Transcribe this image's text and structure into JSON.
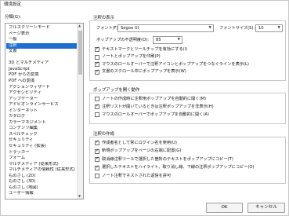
{
  "window": {
    "title": "環境設定"
  },
  "categories": {
    "label": "分類(G):",
    "items": [
      {
        "label": "フルスクリーンモード",
        "bold": false
      },
      {
        "label": "ページ表示",
        "bold": false
      },
      {
        "label": "一般",
        "bold": false
      },
      {
        "label": "注釈",
        "bold": false,
        "selected": true
      },
      {
        "label": "文書",
        "bold": false
      },
      {
        "label": "",
        "bold": false
      },
      {
        "label": "3D とマルチメディア",
        "bold": false
      },
      {
        "label": "JavaScript",
        "bold": false
      },
      {
        "label": "PDF からの変換",
        "bold": false
      },
      {
        "label": "PDF への変換",
        "bold": false
      },
      {
        "label": "アクションウィザード",
        "bold": false
      },
      {
        "label": "アクセシビリティ",
        "bold": false
      },
      {
        "label": "アップデーター",
        "bold": false
      },
      {
        "label": "アドビオンラインサービス",
        "bold": false
      },
      {
        "label": "インターネット",
        "bold": false
      },
      {
        "label": "カタログ",
        "bold": false
      },
      {
        "label": "カラーマネジメント",
        "bold": false
      },
      {
        "label": "コンテンツ編集",
        "bold": false
      },
      {
        "label": "スペルチェック",
        "bold": false
      },
      {
        "label": "セキュリティ",
        "bold": false
      },
      {
        "label": "セキュリティ (拡張)",
        "bold": false
      },
      {
        "label": "トラッカー",
        "bold": false
      },
      {
        "label": "フォーム",
        "bold": false
      },
      {
        "label": "マルチメディア (従来形式)",
        "bold": false
      },
      {
        "label": "マルチメディアの信頼性 (従来形式)",
        "bold": false
      },
      {
        "label": "ものさし (2D)",
        "bold": false
      },
      {
        "label": "ものさし (3D)",
        "bold": false
      },
      {
        "label": "ものさし (地図)",
        "bold": false
      },
      {
        "label": "ユーザー情報",
        "bold": false
      }
    ]
  },
  "display": {
    "title": "注釈の表示",
    "font_label": "フォント(F):",
    "font_value": "Segoe UI",
    "fontsize_label": "フォントサイズ(S):",
    "fontsize_value": "10",
    "opacity_label": "ポップアップの不透明度(O):",
    "opacity_value": "85",
    "options": [
      {
        "label": "テキストマークとツールチップを有効にする(I)",
        "checked": true
      },
      {
        "label": "ノートとポップアップを印刷(P)",
        "checked": false
      },
      {
        "label": "マウスのロールオーバーで注釈アイコンとポップアップをつなぐラインを表示(L)",
        "checked": true
      },
      {
        "label": "文書のスクロール中にポップアップを表示(W)",
        "checked": true
      }
    ]
  },
  "popup": {
    "title": "ポップアップを開く動作",
    "options": [
      {
        "label": "ノートの作成時に注釈用ポップアップを自動的に開く(M)",
        "checked": false
      },
      {
        "label": "注釈リストが開いているときは注釈ポップアップを非表示(H)",
        "checked": true
      },
      {
        "label": "マウスのロールオーバーでポップアップを自動的に開く(A)",
        "checked": false
      }
    ]
  },
  "create": {
    "title": "注釈の作成",
    "options": [
      {
        "label": "作成者名として常にログイン名を使用(U)",
        "checked": true
      },
      {
        "label": "新規ポップアップをページの右端に配置(G)",
        "checked": true
      },
      {
        "label": "取消線注釈ツールで選択した箇所のテキストをポップアップにコピー(T)",
        "checked": true
      },
      {
        "label": "選択したテキストをハイライト、取り消し線、下線の注釈ポップアップにコピー(O)",
        "checked": true
      },
      {
        "label": "ノート注釈でネストされた返信を許可",
        "checked": false
      }
    ]
  },
  "buttons": {
    "ok": "OK",
    "cancel": "キャンセル"
  }
}
